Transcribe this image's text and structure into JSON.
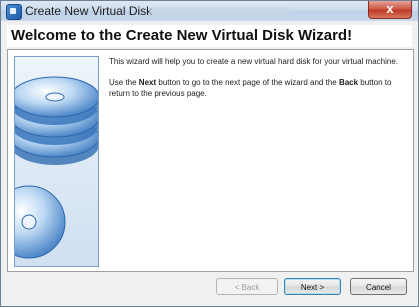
{
  "window": {
    "title": "Create New Virtual Disk",
    "close_symbol": "x"
  },
  "header": {
    "title": "Welcome to the Create New Virtual Disk Wizard!"
  },
  "body": {
    "p1": "This wizard will help you to create a new virtual hard disk for your virtual machine.",
    "p2_parts": [
      "Use the ",
      "Next",
      " button to go to the next page of the wizard and the ",
      "Back",
      " button to return to the previous page."
    ]
  },
  "buttons": {
    "back": "< Back",
    "next": "Next >",
    "cancel": "Cancel"
  },
  "icons": {
    "app": "virtualbox-icon",
    "side_art": "disk-stack-icon"
  },
  "colors": {
    "accent": "#3c7fb1",
    "close": "#c03a25",
    "side_bg": "#cfdff1"
  }
}
